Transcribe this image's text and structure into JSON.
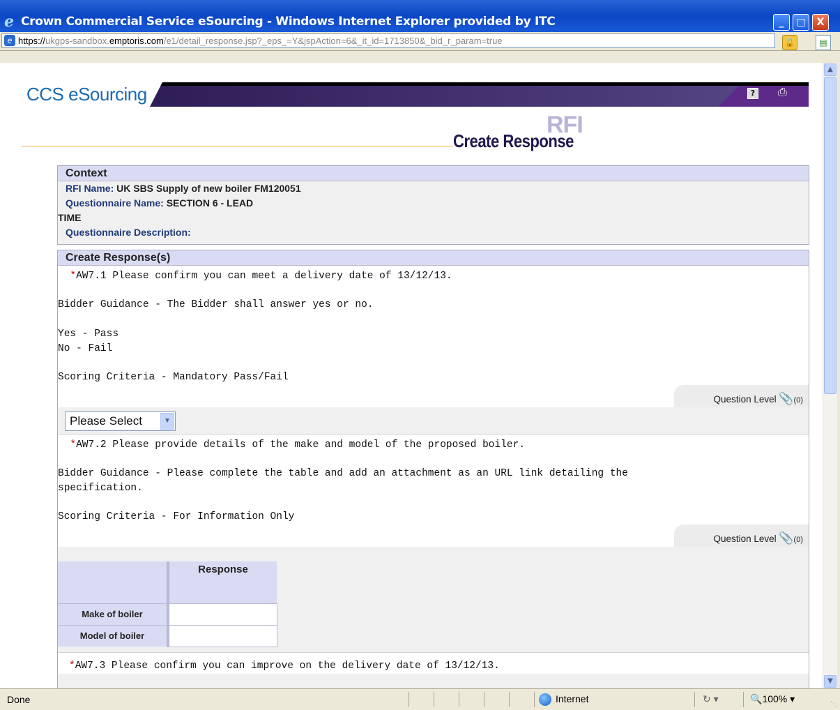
{
  "window": {
    "title": "Crown Commercial Service eSourcing - Windows Internet Explorer provided by ITC",
    "buttons": {
      "minimize": "_",
      "maximize": "□",
      "close": "X"
    }
  },
  "address": {
    "prefix": "https://",
    "sub": "ukgps-sandbox.",
    "host": "emptoris.com",
    "path": "/e1/detail_response.jsp?_eps_=Y&jspAction=6&_it_id=1713850&_bid_r_param=true"
  },
  "header": {
    "logo": "CCS eSourcing",
    "rfi_label": "RFI",
    "page_title": "Create Response",
    "help_icon": "?",
    "print_icon": "print-icon"
  },
  "context": {
    "heading": "Context",
    "rfi_name_label": "RFI Name: ",
    "rfi_name_value": "UK SBS Supply of new boiler FM120051",
    "questionnaire_name_label": "Questionnaire Name: ",
    "questionnaire_name_value": "SECTION 6 - LEAD",
    "questionnaire_name_wrap": "TIME",
    "questionnaire_description_label": "Questionnaire Description:"
  },
  "responses": {
    "heading": "Create Response(s)",
    "q1": {
      "asterisk": "*",
      "text": "AW7.1 Please confirm you can meet a delivery date of 13/12/13.\n\nBidder Guidance - The Bidder shall answer yes or no.\n\nYes - Pass\nNo - Fail\n\nScoring Criteria - Mandatory Pass/Fail",
      "question_level": "Question Level",
      "attachment_count": "(0)",
      "select_value": "Please Select"
    },
    "q2": {
      "asterisk": "*",
      "text": "AW7.2 Please provide details of the make and model of the proposed boiler.\n\nBidder Guidance - Please complete the table and add an attachment as an URL link detailing the\nspecification.\n\nScoring Criteria - For Information Only",
      "question_level": "Question Level",
      "attachment_count": "(0)",
      "table": {
        "column_header": "Response",
        "rows": [
          {
            "label": "Make of boiler",
            "value": ""
          },
          {
            "label": "Model of boiler",
            "value": ""
          }
        ]
      }
    },
    "q3": {
      "asterisk": "*",
      "text": "AW7.3 Please confirm you can improve on the delivery date of 13/12/13."
    }
  },
  "statusbar": {
    "status": "Done",
    "zone": "Internet",
    "protected_mode": "▾",
    "zoom": "100%"
  }
}
